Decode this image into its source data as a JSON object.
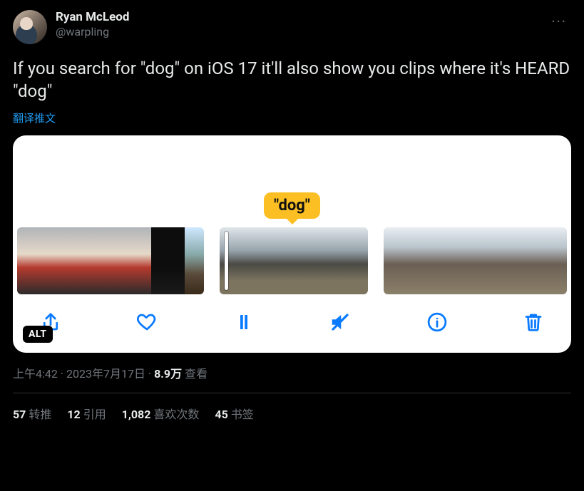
{
  "author": {
    "display_name": "Ryan McLeod",
    "handle": "@warpling"
  },
  "more_glyph": "···",
  "tweet_text": "If you search for \"dog\" on iOS 17 it'll also show you clips where it's HEARD \"dog\"",
  "translate_label": "翻译推文",
  "media": {
    "tooltip_text": "\"dog\"",
    "alt_badge": "ALT",
    "toolbar": {
      "share": "share-icon",
      "like": "heart-icon",
      "pause": "pause-icon",
      "mute": "volume-mute-icon",
      "info": "info-icon",
      "trash": "trash-icon"
    }
  },
  "meta": {
    "time": "上午4:42",
    "dot1": " · ",
    "date": "2023年7月17日",
    "dot2": " · ",
    "views_num": "8.9万",
    "views_label": " 查看"
  },
  "stats": {
    "retweets_num": "57",
    "retweets_label": "转推",
    "quotes_num": "12",
    "quotes_label": "引用",
    "likes_num": "1,082",
    "likes_label": "喜欢次数",
    "bookmarks_num": "45",
    "bookmarks_label": "书签"
  }
}
